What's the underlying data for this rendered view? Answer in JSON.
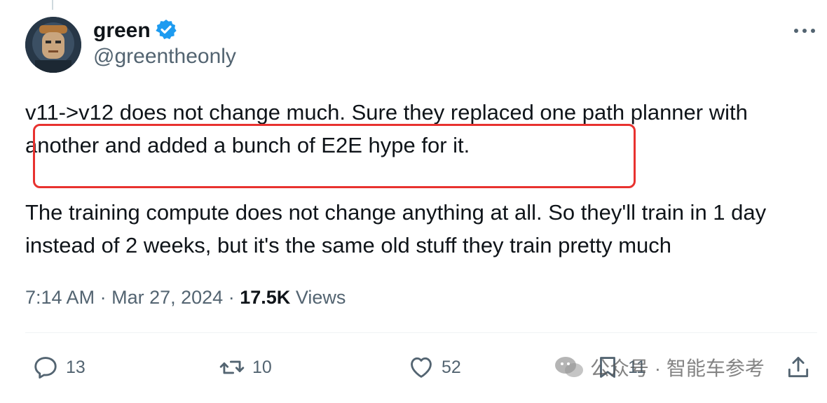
{
  "tweet": {
    "author": {
      "name": "green",
      "handle": "@greentheonly",
      "verified": true
    },
    "paragraphs": [
      "v11->v12 does not change much. Sure they replaced one path planner with another and added a bunch of E2E hype for it.",
      "The training compute does not change anything at all. So they'll train in 1 day instead of 2 weeks, but it's the same old stuff they train pretty much"
    ],
    "time": "7:14 AM",
    "date": "Mar 27, 2024",
    "separator": "·",
    "views_count": "17.5K",
    "views_label": "Views"
  },
  "actions": {
    "replies": "13",
    "retweets": "10",
    "likes": "52",
    "bookmarks": "11"
  },
  "watermark": {
    "text": "公众号 · 智能车参考"
  },
  "colors": {
    "verified_badge": "#1d9bf0",
    "highlight_box": "#e8322f",
    "secondary_text": "#536471",
    "primary_text": "#0f1419"
  },
  "icons": {
    "verified": "verified-badge-icon",
    "more": "more-horizontal-icon",
    "reply": "reply-icon",
    "retweet": "retweet-icon",
    "like": "heart-icon",
    "bookmark": "bookmark-icon",
    "share": "share-icon",
    "watermark": "wechat-icon"
  }
}
